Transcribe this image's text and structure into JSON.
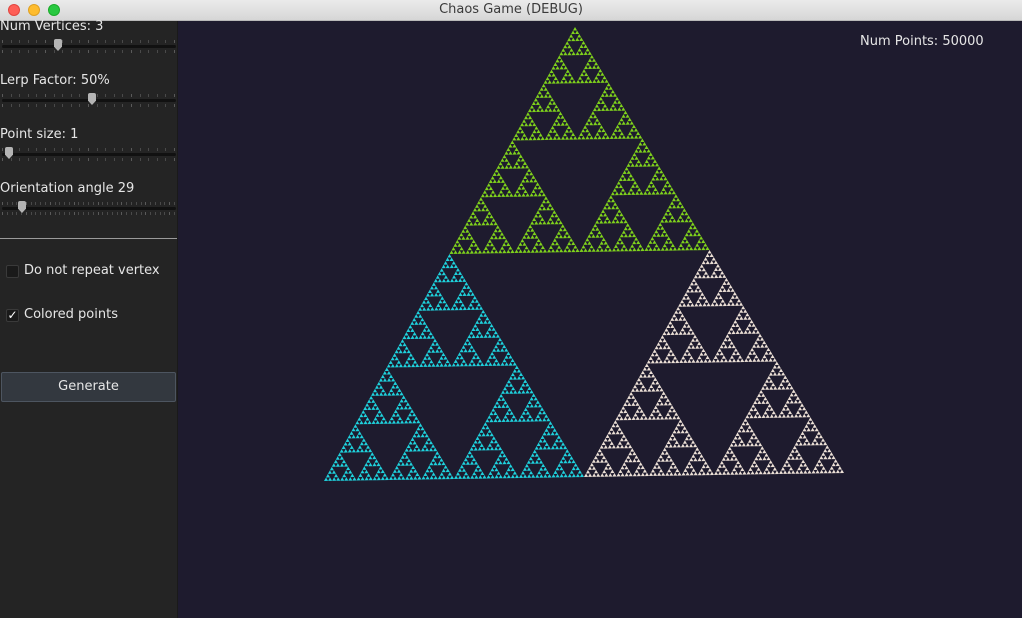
{
  "window": {
    "title": "Chaos Game (DEBUG)"
  },
  "sidebar": {
    "num_vertices": {
      "label": "Num Vertices: 3",
      "value": 3
    },
    "lerp_factor": {
      "label": "Lerp Factor: 50%",
      "value": 50
    },
    "point_size": {
      "label": "Point size: 1",
      "value": 1
    },
    "orientation": {
      "label": "Orientation angle 29",
      "value": 29
    },
    "do_not_repeat": {
      "label": "Do not repeat vertex",
      "checked": false
    },
    "colored_points": {
      "label": "Colored points",
      "checked": true,
      "mark": "✓"
    },
    "generate_label": "Generate"
  },
  "canvas": {
    "num_points_text": "Num Points: 50000",
    "colors": {
      "background": "#1e1b2e",
      "top": "#7fd21c",
      "left": "#1ed2dd",
      "right": "#ece0d6"
    }
  }
}
